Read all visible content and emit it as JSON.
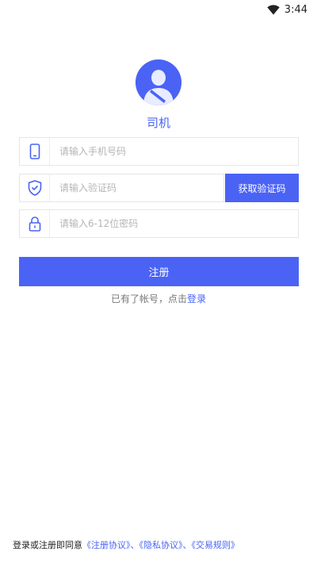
{
  "status_bar": {
    "time": "3:44",
    "wifi_icon": "wifi-icon"
  },
  "profile": {
    "avatar_icon": "driver-avatar-icon",
    "role": "司机"
  },
  "form": {
    "phone_placeholder": "请输入手机号码",
    "phone_icon": "phone-icon",
    "code_placeholder": "请输入验证码",
    "code_icon": "shield-check-icon",
    "get_code_label": "获取验证码",
    "password_placeholder": "请输入6-12位密码",
    "password_icon": "lock-icon",
    "register_label": "注册"
  },
  "login_hint": {
    "text": "已有了帐号，点击",
    "link": "登录"
  },
  "agreement": {
    "prefix": "登录或注册即同意",
    "terms": "《注册协议》",
    "sep1": "、",
    "privacy": "《隐私协议》",
    "sep2": "、",
    "trade": "《交易规则》"
  },
  "colors": {
    "accent": "#4a63f5",
    "border": "#e6e6e6",
    "placeholder": "#b5b5b5"
  }
}
